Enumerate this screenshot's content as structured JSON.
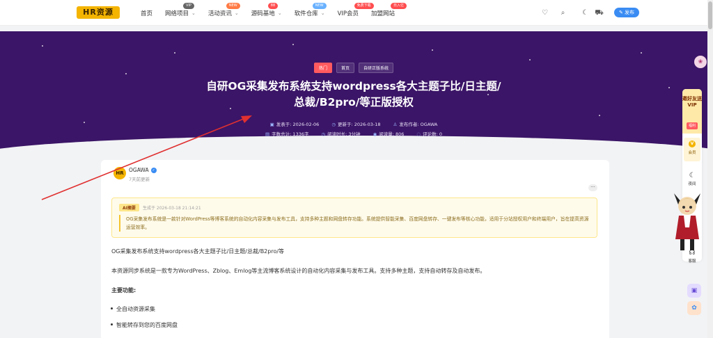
{
  "header": {
    "logo_text": "HR资源",
    "nav": [
      {
        "label": "首页",
        "badge": "",
        "dropdown": false
      },
      {
        "label": "网络项目",
        "badge": "VIP",
        "dropdown": true
      },
      {
        "label": "活动资讯",
        "badge": "NEW",
        "dropdown": true
      },
      {
        "label": "源码基地",
        "badge": "88",
        "dropdown": true
      },
      {
        "label": "软件仓库",
        "badge": "NEW",
        "dropdown": true
      },
      {
        "label": "VIP会员",
        "badge": "免费下载",
        "dropdown": false
      },
      {
        "label": "加盟网站",
        "badge": "日入亿",
        "dropdown": false
      }
    ],
    "publish_label": "发布"
  },
  "hero": {
    "tags": [
      "热门",
      "首页",
      "自研正版系统"
    ],
    "title": "自研OG采集发布系统支持wordpress各大主题子比/日主题/总裁/B2pro/等正版授权",
    "meta_line1": {
      "published": "发表于: 2026-02-06",
      "updated": "更新于: 2026-03-18",
      "author": "发布作者: OGAWA"
    },
    "meta_line2": {
      "words": "字数总计: 1336字",
      "read_time": "阅读时长: 3分钟",
      "views": "阅读量: 806",
      "comments": "评论数: 0"
    }
  },
  "post": {
    "author_name": "OGAWA",
    "updated_ago": "7天前更新",
    "ai_summary": {
      "tag": "AI摘要",
      "time": "生成于 2026-03-18 21:14:21",
      "text": "OG采集发布系统是一款针对WordPress等博客系统的自动化内容采集与发布工具，支持多种主题和网盘转存功能。系统提供智能采集、百度网盘转存、一键发布等核心功能，适用于分站授权用户和终端用户，旨在提高资源运营效率。"
    },
    "para1": "OG采集发布系统支持wordpress各大主题子比/日主题/总裁/B2pro/等",
    "para2": "本资源同步系统是一款专为WordPress、Zblog、Emlog等主流博客系统设计的自动化内容采集与发布工具。支持多种主题，支持自动转存及自动发布。",
    "features_heading": "主要功能:",
    "features": [
      "全自动资源采集",
      "智能转存到您的百度网盘"
    ]
  },
  "sidebar": {
    "invite_text": "邀好友送VIP",
    "invite_btn": "福利",
    "vip_label": "会员",
    "night_label": "夜间",
    "service_label": "客服"
  },
  "colors": {
    "hero_bg": "#3b1567",
    "accent_blue": "#3a8cf3",
    "hot_red": "#ff5a5f",
    "logo_yellow": "#f4b400",
    "annotation_arrow": "#e03030"
  }
}
